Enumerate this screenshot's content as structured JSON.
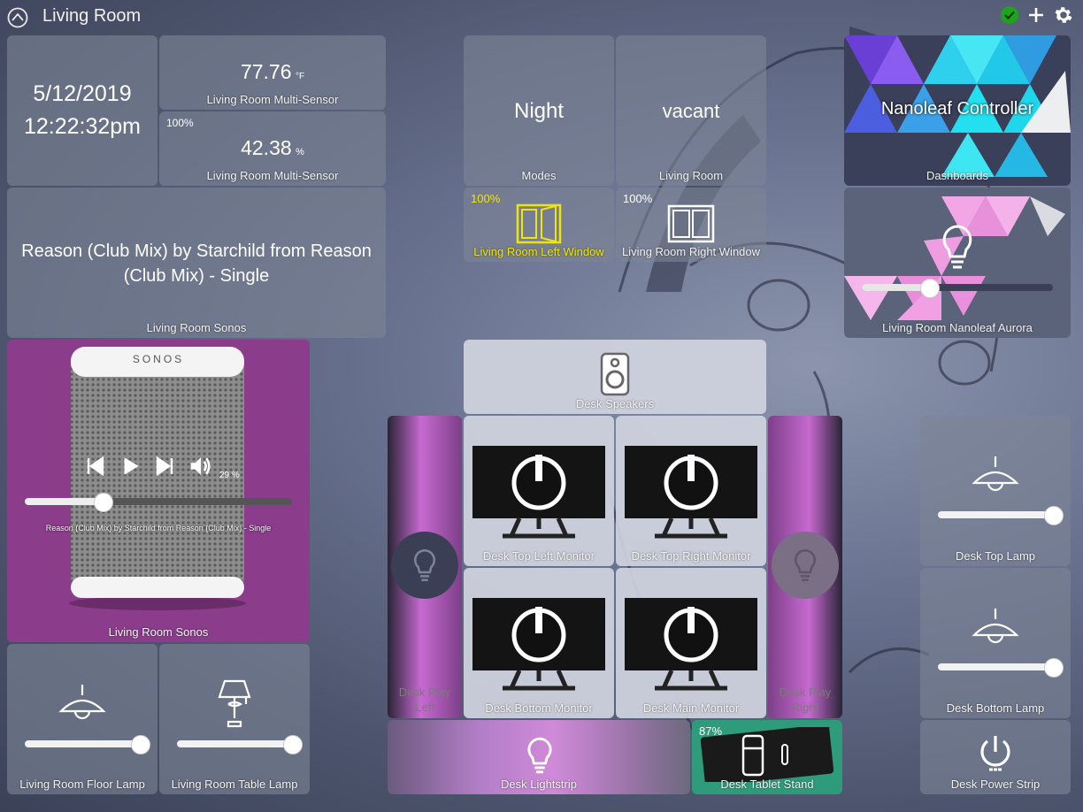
{
  "header": {
    "title": "Living Room",
    "home_icon": "home-assistant-icon",
    "status_icon": "check-circle-icon",
    "add_icon": "plus-icon",
    "settings_icon": "gear-icon",
    "status_color": "#1ea31e"
  },
  "clock": {
    "date": "5/12/2019",
    "time": "12:22:32pm"
  },
  "temperature": {
    "value": "77.76",
    "unit": "°F",
    "label": "Living Room Multi-Sensor"
  },
  "humidity": {
    "battery": "100%",
    "value": "42.38",
    "unit": "%",
    "label": "Living Room Multi-Sensor"
  },
  "modes": {
    "value": "Night",
    "label": "Modes"
  },
  "presence": {
    "value": "vacant",
    "label": "Living Room"
  },
  "dashboards": {
    "title": "Nanoleaf Controller",
    "label": "Dashboards"
  },
  "left_window": {
    "battery": "100%",
    "label": "Living Room Left Window",
    "highlight": "#f0e600"
  },
  "right_window": {
    "battery": "100%",
    "label": "Living Room Right Window"
  },
  "now_playing": {
    "text": "Reason (Club Mix) by Starchild from Reason (Club Mix) - Single",
    "label": "Living Room Sonos"
  },
  "aurora": {
    "label": "Living Room Nanoleaf Aurora",
    "level": 0.35
  },
  "sonos_player": {
    "brand": "SONOS",
    "volume": "29 %",
    "volume_level": 0.29,
    "track": "Reason (Club Mix) by Starchild from Reason (Club Mix) - Single",
    "label": "Living Room Sonos"
  },
  "desk_speakers": {
    "label": "Desk Speakers"
  },
  "desk_play_left": {
    "label_line1": "Desk Play",
    "label_line2": "Left"
  },
  "desk_play_right": {
    "label_line1": "Desk Play",
    "label_line2": "Right"
  },
  "monitors": {
    "top_left": "Desk Top Left Monitor",
    "top_right": "Desk Top Right Monitor",
    "bottom": "Desk Bottom Monitor",
    "main": "Desk Main Monitor"
  },
  "desk_top_lamp": {
    "label": "Desk Top Lamp",
    "level": 1.0
  },
  "desk_bottom_lamp": {
    "label": "Desk Bottom Lamp",
    "level": 1.0
  },
  "floor_lamp": {
    "label": "Living Room Floor Lamp",
    "level": 1.0
  },
  "table_lamp": {
    "label": "Living Room Table Lamp",
    "level": 1.0
  },
  "lightstrip": {
    "label": "Desk Lightstrip"
  },
  "tablet_stand": {
    "battery": "87%",
    "label": "Desk Tablet Stand"
  },
  "power_strip": {
    "label": "Desk Power Strip"
  }
}
